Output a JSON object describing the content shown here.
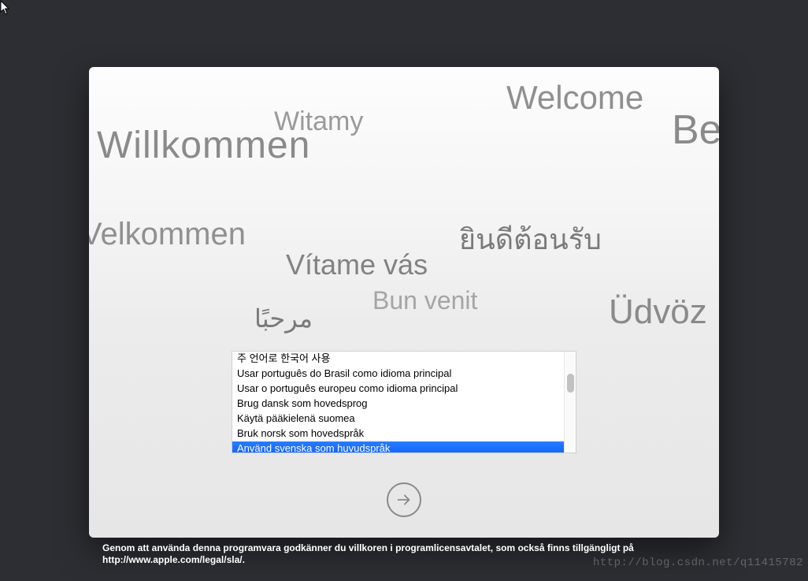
{
  "welcome_words": {
    "welcome": "Welcome",
    "witamy": "Witamy",
    "willkommen": "Willkommen",
    "bem": "Bem",
    "velkommen": "Velkommen",
    "thai": "ยินดีต้อนรับ",
    "vitame": "Vítame vás",
    "bun": "Bun venit",
    "arabic": "مرحبًا",
    "udvoz": "Üdvöz"
  },
  "language_list": {
    "items": [
      {
        "label": "주 언어로 한국어 사용",
        "selected": false
      },
      {
        "label": "Usar português do Brasil como idioma principal",
        "selected": false
      },
      {
        "label": "Usar o português europeu como idioma principal",
        "selected": false
      },
      {
        "label": "Brug dansk som hovedsprog",
        "selected": false
      },
      {
        "label": "Käytä pääkielenä suomea",
        "selected": false
      },
      {
        "label": "Bruk norsk som hovedspråk",
        "selected": false
      },
      {
        "label": "Använd svenska som huvudspråk",
        "selected": true
      }
    ]
  },
  "footer": {
    "text": "Genom att använda denna programvara godkänner du villkoren i programlicensavtalet, som också finns tillgängligt på http://www.apple.com/legal/sla/."
  },
  "watermark": "http://blog.csdn.net/q11415782"
}
